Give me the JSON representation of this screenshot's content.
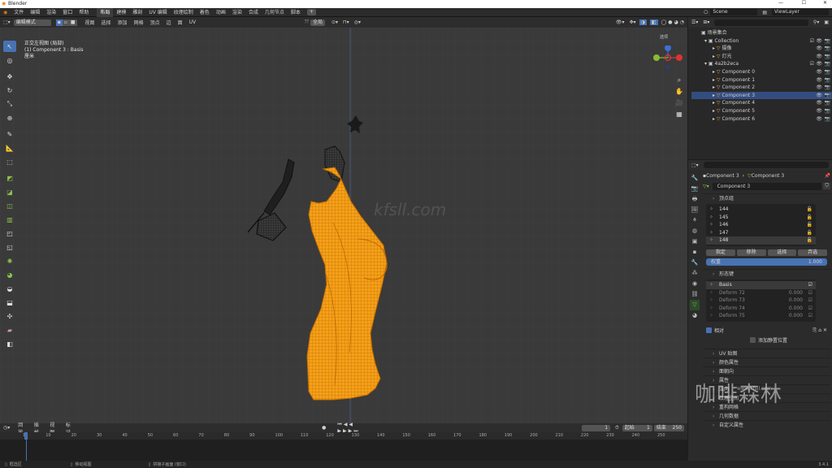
{
  "window": {
    "title": "Blender",
    "version": "3.4.1"
  },
  "menu": [
    "文件",
    "编辑",
    "渲染",
    "窗口",
    "帮助"
  ],
  "workspaces": [
    "布局",
    "建模",
    "雕刻",
    "UV 编辑",
    "纹理绘制",
    "着色",
    "动画",
    "渲染",
    "合成",
    "几何节点",
    "脚本"
  ],
  "scene": {
    "name": "Scene",
    "view_layer": "ViewLayer"
  },
  "viewport": {
    "mode": "编辑模式",
    "menus": [
      "视图",
      "选择",
      "添加",
      "网格",
      "顶点",
      "边",
      "面",
      "UV"
    ],
    "transform": "全局",
    "options": "选项",
    "overlay_title": "正交左视图 (局部)",
    "overlay_object": "(1) Component 3 : Basis",
    "overlay_unit": "厘米",
    "watermark": "kfsll.com"
  },
  "outliner": {
    "root": "场景集合",
    "items": [
      {
        "label": "Collection",
        "depth": 0,
        "open": true
      },
      {
        "label": "摄像",
        "depth": 1
      },
      {
        "label": "灯光",
        "depth": 1
      },
      {
        "label": "4a2b2eca",
        "depth": 0,
        "open": true
      },
      {
        "label": "Component 0",
        "depth": 1
      },
      {
        "label": "Component 1",
        "depth": 1
      },
      {
        "label": "Component 2",
        "depth": 1
      },
      {
        "label": "Component 3",
        "depth": 1,
        "selected": true
      },
      {
        "label": "Component 4",
        "depth": 1
      },
      {
        "label": "Component 5",
        "depth": 1
      },
      {
        "label": "Component 6",
        "depth": 1
      }
    ]
  },
  "properties": {
    "breadcrumb": [
      "Component 3",
      "Component 3"
    ],
    "mesh_name": "Component 3",
    "vertex_groups_title": "顶点组",
    "vertex_groups": [
      "144",
      "145",
      "146",
      "147",
      "148"
    ],
    "vg_buttons": [
      "指定",
      "移除",
      "选择",
      "弃选"
    ],
    "weight_label": "权重",
    "weight_value": "1.000",
    "shape_keys_title": "形态键",
    "shape_keys": [
      {
        "name": "Basis",
        "value": ""
      },
      {
        "name": "Deform 72",
        "value": "0.000"
      },
      {
        "name": "Deform 73",
        "value": "0.000"
      },
      {
        "name": "Deform 74",
        "value": "0.000"
      },
      {
        "name": "Deform 75",
        "value": "0.000"
      }
    ],
    "relative_label": "相对",
    "add_rest_label": "添加静置位置",
    "sections": [
      "UV 贴图",
      "颜色属性",
      "面朝向",
      "属性",
      "法向",
      "纹理空间",
      "重构网格",
      "几何数据",
      "自定义属性"
    ]
  },
  "timeline": {
    "menus": [
      "回放",
      "插帧",
      "视图",
      "标记"
    ],
    "current_frame": "1",
    "start_label": "起始",
    "start": "1",
    "end_label": "结束",
    "end": "250",
    "ticks": [
      "1",
      "10",
      "20",
      "30",
      "40",
      "50",
      "60",
      "70",
      "80",
      "90",
      "100",
      "110",
      "120",
      "130",
      "140",
      "150",
      "160",
      "170",
      "180",
      "190",
      "200",
      "210",
      "220",
      "230",
      "240",
      "250"
    ]
  },
  "status": [
    "框选区",
    "移动视图",
    "拼接子画面 (窗口)"
  ],
  "brand_watermark": {
    "logo_text": "咖啡森林",
    "url": "www.kfsll.com"
  }
}
